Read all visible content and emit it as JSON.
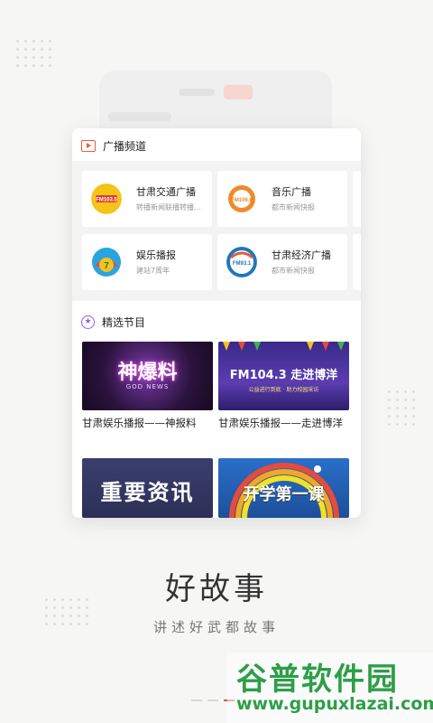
{
  "radio_section": {
    "title": "广播频道",
    "channels": [
      {
        "name": "甘肃交通广播",
        "desc": "转播新闻联播转播…",
        "logo_text": "FM103.5"
      },
      {
        "name": "音乐广播",
        "desc": "都市新闻快报",
        "logo_text": "FM106.6"
      },
      {
        "name": "娱乐播报",
        "desc": "建站7周年",
        "logo_text": "7"
      },
      {
        "name": "甘肃经济广播",
        "desc": "都市新闻快报",
        "logo_text": "FM93.1"
      }
    ]
  },
  "featured_section": {
    "title": "精选节目",
    "programs": [
      {
        "caption": "甘肃娱乐播报——神报料",
        "thumb_text": "神爆料",
        "thumb_sub": "GOD NEWS"
      },
      {
        "caption": "甘肃娱乐播报——走进博洋",
        "thumb_text": "FM104.3 走进博洋",
        "thumb_sub": "公益进行到底 · 助力校园采访"
      },
      {
        "caption": "",
        "thumb_text": "重要资讯",
        "thumb_sub": ""
      },
      {
        "caption": "",
        "thumb_text": "开学第一课",
        "thumb_sub": ""
      }
    ]
  },
  "hero": {
    "title": "好故事",
    "subtitle": "讲述好武都故事"
  },
  "watermark": {
    "line1": "谷普软件园",
    "line2": "www.gupuxlazai.com"
  },
  "colors": {
    "accent": "#e8573c",
    "purple": "#8b66d6",
    "watermark_green": "#2e9e48"
  }
}
